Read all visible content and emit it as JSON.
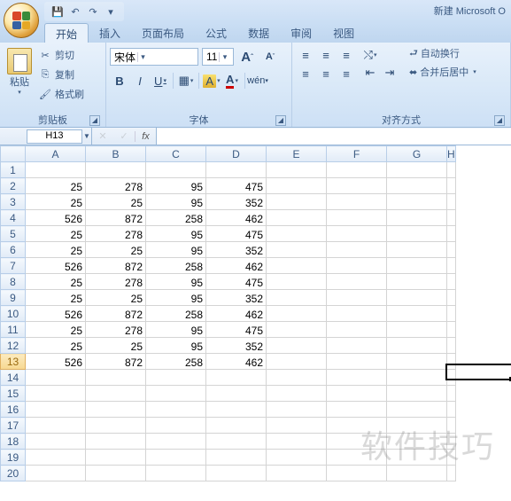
{
  "window": {
    "title": "新建 Microsoft O"
  },
  "qat": {
    "save": "💾",
    "undo": "↶",
    "redo": "↷"
  },
  "tabs": [
    "开始",
    "插入",
    "页面布局",
    "公式",
    "数据",
    "审阅",
    "视图"
  ],
  "activeTab": 0,
  "ribbon": {
    "clipboard": {
      "paste": "粘贴",
      "cut": "剪切",
      "copy": "复制",
      "format": "格式刷",
      "label": "剪贴板"
    },
    "font": {
      "name": "宋体",
      "size": "11",
      "grow": "A",
      "shrink": "A",
      "bold": "B",
      "italic": "I",
      "underline": "U",
      "label": "字体"
    },
    "align": {
      "wrap": "自动换行",
      "merge": "合并后居中",
      "label": "对齐方式"
    }
  },
  "formulaBar": {
    "nameBox": "H13",
    "fx": "fx",
    "formula": ""
  },
  "columns": [
    "A",
    "B",
    "C",
    "D",
    "E",
    "F",
    "G",
    "H"
  ],
  "rowCount": 20,
  "selectedRow": 13,
  "cells": {
    "2": {
      "A": "25",
      "B": "278",
      "C": "95",
      "D": "475"
    },
    "3": {
      "A": "25",
      "B": "25",
      "C": "95",
      "D": "352"
    },
    "4": {
      "A": "526",
      "B": "872",
      "C": "258",
      "D": "462"
    },
    "5": {
      "A": "25",
      "B": "278",
      "C": "95",
      "D": "475"
    },
    "6": {
      "A": "25",
      "B": "25",
      "C": "95",
      "D": "352"
    },
    "7": {
      "A": "526",
      "B": "872",
      "C": "258",
      "D": "462"
    },
    "8": {
      "A": "25",
      "B": "278",
      "C": "95",
      "D": "475"
    },
    "9": {
      "A": "25",
      "B": "25",
      "C": "95",
      "D": "352"
    },
    "10": {
      "A": "526",
      "B": "872",
      "C": "258",
      "D": "462"
    },
    "11": {
      "A": "25",
      "B": "278",
      "C": "95",
      "D": "475"
    },
    "12": {
      "A": "25",
      "B": "25",
      "C": "95",
      "D": "352"
    },
    "13": {
      "A": "526",
      "B": "872",
      "C": "258",
      "D": "462"
    }
  },
  "watermark": "软件技巧"
}
